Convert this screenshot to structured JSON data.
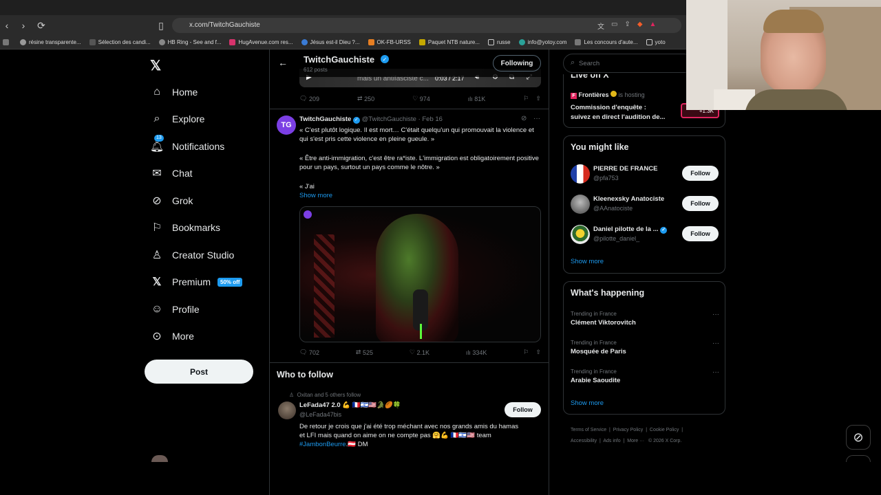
{
  "browser": {
    "url": "x.com/TwitchGauchiste",
    "bookmarks": [
      "résine transparente...",
      "Sélection des candi...",
      "HB Ring - See and f...",
      "HugAvenue.com res...",
      "Jésus est-il Dieu ?...",
      "OK-FB-URSS",
      "Paquet NTB nature...",
      "russe",
      "info@yotoy.com",
      "Les concours d'aute...",
      "yoto"
    ]
  },
  "nav": {
    "items": [
      {
        "label": "Home",
        "icon": "home-icon"
      },
      {
        "label": "Explore",
        "icon": "search-icon"
      },
      {
        "label": "Notifications",
        "icon": "bell-icon",
        "badge": "13"
      },
      {
        "label": "Chat",
        "icon": "mail-icon"
      },
      {
        "label": "Grok",
        "icon": "grok-icon"
      },
      {
        "label": "Bookmarks",
        "icon": "bookmark-icon"
      },
      {
        "label": "Creator Studio",
        "icon": "creator-icon"
      },
      {
        "label": "Premium",
        "icon": "x-icon",
        "badge": "50% off"
      },
      {
        "label": "Profile",
        "icon": "person-icon"
      },
      {
        "label": "More",
        "icon": "more-icon"
      }
    ],
    "post_label": "Post"
  },
  "profile_header": {
    "name": "TwitchGauchiste",
    "posts": "612 posts",
    "following_label": "Following"
  },
  "prev_tweet": {
    "video_caption": "mais un antifasciste c...",
    "time": "0:03 / 2:17",
    "replies": "209",
    "reposts": "250",
    "likes": "974",
    "views": "81K"
  },
  "tweet": {
    "name": "TwitchGauchiste",
    "handle": "@TwitchGauchiste",
    "date": "· Feb 16",
    "para1": "« C'est plutôt logique. Il est mort… C'était quelqu'un qui promouvait la violence et qui s'est pris cette violence en pleine gueule. »",
    "para2": "« Être anti-immigration, c'est être ra*iste. L'immigration est obligatoirement positive pour un pays, surtout un pays comme le nôtre. »",
    "para3": "« J'ai",
    "show_more": "Show more",
    "replies": "702",
    "reposts": "525",
    "likes": "2.1K",
    "views": "334K"
  },
  "who_to_follow": {
    "title": "Who to follow",
    "context": "Oxitan and 5 others follow",
    "name": "LeFada47 2.0 💪 🇫🇷🇮🇱🇺🇸🐊🏉🍀",
    "handle": "@LeFada47bis",
    "bio1": "De retour je crois que j'ai été trop méchant avec nos grands amis du hamas",
    "bio2": "et LFI mais quand on aime on ne compte pas 🤗💪 🇫🇷🇮🇱🇺🇸 team",
    "bio_tag": "#JambonBeurre",
    "bio_end": ".🇦🇹 DM",
    "follow_label": "Follow"
  },
  "right": {
    "search_placeholder": "Search",
    "live_title": "Live on X",
    "live_host": "Frontières",
    "live_hosting": "is hosting",
    "live_text1": "Commission d'enquête :",
    "live_text2": "suivez en direct l'audition de...",
    "live_count": "+1.3K",
    "might_like_title": "You might like",
    "suggestions": [
      {
        "name": "PIERRE DE FRANCE",
        "handle": "@pfa753"
      },
      {
        "name": "Kleenexsky Anatociste",
        "handle": "@AAnatociste"
      },
      {
        "name": "Daniel pilotte de la ...",
        "handle": "@pilotte_daniel_"
      }
    ],
    "follow_label": "Follow",
    "show_more": "Show more",
    "happening_title": "What's happening",
    "trends": [
      {
        "context": "Trending in France",
        "name": "Clément Viktorovitch"
      },
      {
        "context": "Trending in France",
        "name": "Mosquée de Paris"
      },
      {
        "context": "Trending in France",
        "name": "Arabie Saoudite"
      }
    ],
    "footer": [
      "Terms of Service",
      "Privacy Policy",
      "Cookie Policy",
      "Accessibility",
      "Ads info",
      "More ···",
      "© 2026 X Corp."
    ]
  }
}
